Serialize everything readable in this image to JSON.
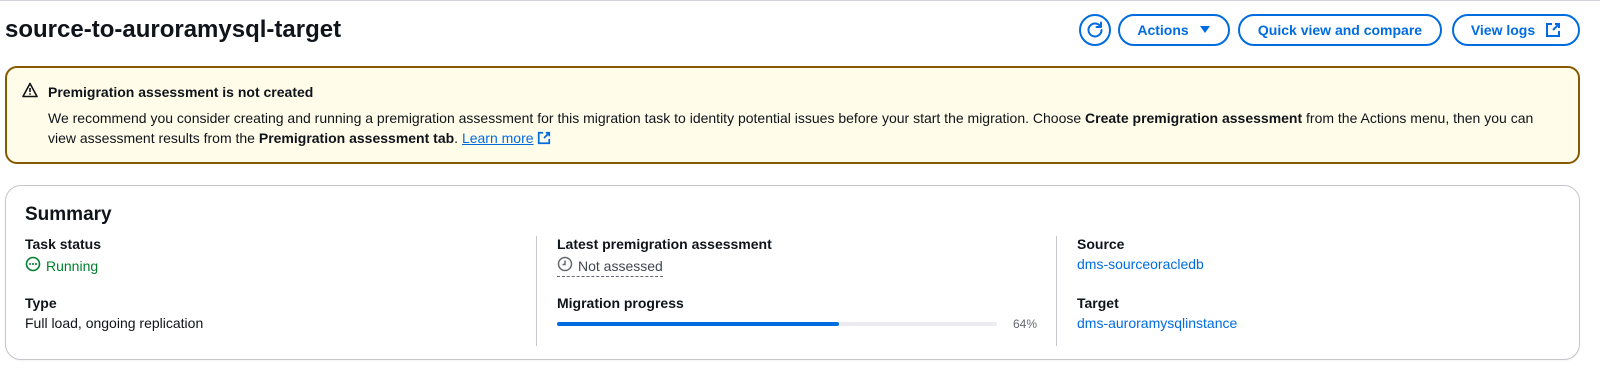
{
  "header": {
    "title": "source-to-auroramysql-target",
    "actions_label": "Actions",
    "quick_view_label": "Quick view and compare",
    "view_logs_label": "View logs"
  },
  "alert": {
    "title": "Premigration assessment is not created",
    "body_part1": "We recommend you consider creating and running a premigration assessment for this migration task to identity potential issues before your start the migration. Choose ",
    "body_bold1": "Create premigration assessment",
    "body_part2": " from the Actions menu, then you can view assessment results from the ",
    "body_bold2": "Premigration assessment tab",
    "body_part3": ". ",
    "learn_more": "Learn more"
  },
  "summary": {
    "title": "Summary",
    "task_status_label": "Task status",
    "task_status_value": "Running",
    "type_label": "Type",
    "type_value": "Full load, ongoing replication",
    "assessment_label": "Latest premigration assessment",
    "assessment_value": "Not assessed",
    "progress_label": "Migration progress",
    "progress_percent": 64,
    "progress_text": "64%",
    "source_label": "Source",
    "source_value": "dms-sourceoracledb",
    "target_label": "Target",
    "target_value": "dms-auroramysqlinstance"
  },
  "icons": {
    "refresh": "refresh-icon",
    "actions_caret": "caret-down-icon",
    "external": "external-link-icon",
    "warning": "warning-icon",
    "status_running": "status-in-progress-icon",
    "status_pending": "clock-icon"
  },
  "colors": {
    "accent": "#006ce0",
    "warning_border": "#855900",
    "warning_bg": "#fffce9",
    "success": "#00802f"
  }
}
